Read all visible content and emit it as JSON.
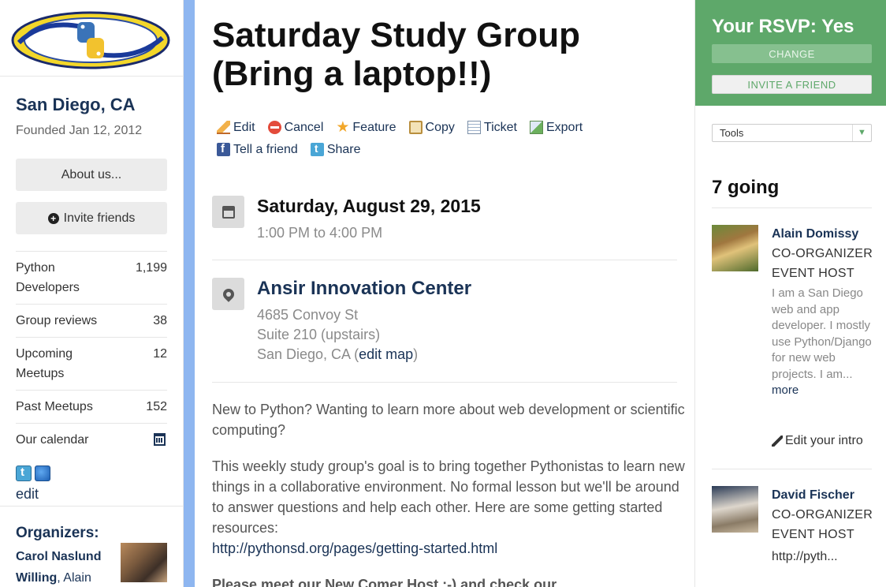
{
  "group": {
    "city": "San Diego, CA",
    "founded": "Founded Jan 12, 2012",
    "about_label": "About us...",
    "invite_label": "Invite friends",
    "stats": [
      {
        "label": "Python Developers",
        "value": "1,199"
      },
      {
        "label": "Group reviews",
        "value": "38"
      },
      {
        "label": "Upcoming Meetups",
        "value": "12"
      },
      {
        "label": "Past Meetups",
        "value": "152"
      },
      {
        "label": "Our calendar",
        "icon": "calendar-icon"
      }
    ],
    "edit_label": "edit",
    "organizers_title": "Organizers:",
    "organizer_bold": "Carol Naslund Willing",
    "organizer_rest": ", Alain"
  },
  "event": {
    "title": "Saturday Study Group (Bring a laptop!!)",
    "actions": [
      {
        "label": "Edit",
        "icon": "pencil-icon"
      },
      {
        "label": "Cancel",
        "icon": "cancel-icon"
      },
      {
        "label": "Feature",
        "icon": "star-icon"
      },
      {
        "label": "Copy",
        "icon": "copy-icon"
      },
      {
        "label": "Ticket",
        "icon": "ticket-icon"
      },
      {
        "label": "Export",
        "icon": "export-icon"
      },
      {
        "label": "Tell a friend",
        "icon": "facebook-icon"
      },
      {
        "label": "Share",
        "icon": "twitter-icon"
      }
    ],
    "date": "Saturday, August 29, 2015",
    "time": "1:00 PM to 4:00 PM",
    "venue": "Ansir Innovation Center",
    "address_line1": "4685 Convoy St",
    "address_line2": "Suite 210 (upstairs)",
    "address_line3": "San Diego, CA (",
    "edit_map_label": "edit map",
    "address_close": ")",
    "desc_p1": "New to Python? Wanting to learn more about web development or scientific computing?",
    "desc_p2": "This weekly study group's goal is to bring together Pythonistas to learn new things in a collaborative environment. No formal lesson but we'll be around to answer questions and help each other. Here are some getting started resources:",
    "desc_url": "http://pythonsd.org/pages/getting-started.html",
    "desc_p3": "Please meet our New Comer Host :-) and check our"
  },
  "rsvp": {
    "title": "Your RSVP: Yes",
    "change_label": "CHANGE",
    "invite_label": "INVITE A FRIEND",
    "tools_label": "Tools",
    "going": "7 going",
    "members": [
      {
        "name": "Alain Domissy",
        "role1": "CO-ORGANIZER",
        "role2": "EVENT HOST",
        "bio": "I am a San Diego web and app developer. I mostly use Python/Django for new web projects. I am...",
        "more": "more",
        "edit_intro": "Edit your intro"
      },
      {
        "name": "David Fischer",
        "role1": "CO-ORGANIZER",
        "role2": "EVENT HOST",
        "url": "http://pyth..."
      }
    ]
  },
  "colors": {
    "accent_green": "#5ea86a",
    "link_navy": "#1a3356",
    "strip_blue": "#8eb6f0"
  }
}
